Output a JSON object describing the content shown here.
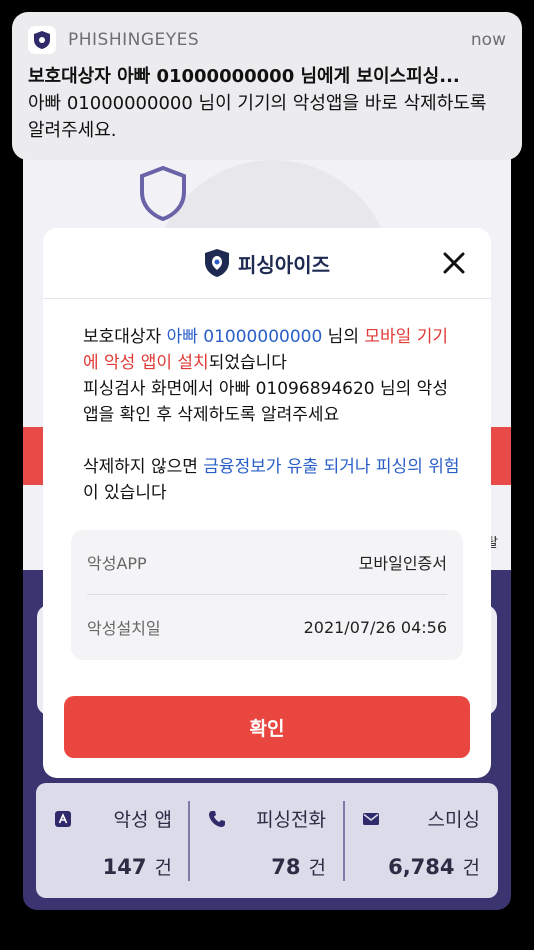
{
  "notification": {
    "app_name": "PHISHINGEYES",
    "time": "now",
    "title": "보호대상자 아빠 01000000000 님에게 보이스피싱...",
    "body": "아빠 01000000000 님이 기기의 악성앱을 바로 삭제하도록 알려주세요."
  },
  "background": {
    "right_edge_text": "탈"
  },
  "modal": {
    "logo_text": "피싱아이즈",
    "message": {
      "p1_a": "보호대상자 ",
      "p1_b": "아빠 01000000000",
      "p1_c": " 님의 ",
      "p1_d": "모바일 기기에 악성 앱이 설치",
      "p1_e": "되었습니다",
      "p2": "피싱검사 화면에서 아빠 01096894620 님의 악성 앱을 확인 후 삭제하도록 알려주세요",
      "p3_a": "삭제하지 않으면 ",
      "p3_b": "금융정보가 유출 되거나 피싱의 위험",
      "p3_c": "이 있습니다"
    },
    "info": [
      {
        "key": "악성APP",
        "value": "모바일인증서"
      },
      {
        "key": "악성설치일",
        "value": "2021/07/26 04:56"
      }
    ],
    "confirm_label": "확인"
  },
  "stats": [
    {
      "label": "악성 앱",
      "count": "147",
      "unit": "건",
      "icon": "app-icon"
    },
    {
      "label": "피싱전화",
      "count": "78",
      "unit": "건",
      "icon": "phone-icon"
    },
    {
      "label": "스미싱",
      "count": "6,784",
      "unit": "건",
      "icon": "mail-icon"
    }
  ],
  "colors": {
    "accent_red": "#e8463f",
    "link_blue": "#2a5fc8",
    "brand_navy": "#1e2a52",
    "app_bg_purple": "#3a3470"
  }
}
